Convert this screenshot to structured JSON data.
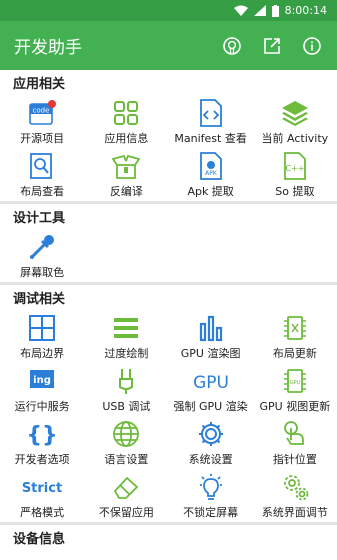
{
  "status": {
    "time": "8:00:14",
    "network": "LTE"
  },
  "app": {
    "title": "开发助手",
    "accent": "#43b152",
    "icon_color": "#6dbb3a",
    "blue": "#2b7fd8"
  },
  "sections": [
    {
      "title": "应用相关",
      "items": [
        {
          "label": "开源项目",
          "icon": "code-icon"
        },
        {
          "label": "应用信息",
          "icon": "apps-grid-icon"
        },
        {
          "label": "Manifest 查看",
          "icon": "code-file-icon"
        },
        {
          "label": "当前 Activity",
          "icon": "layers-icon"
        },
        {
          "label": "布局查看",
          "icon": "layout-search-icon"
        },
        {
          "label": "反编译",
          "icon": "box-open-icon"
        },
        {
          "label": "Apk 提取",
          "icon": "apk-file-icon"
        },
        {
          "label": "So 提取",
          "icon": "cpp-file-icon"
        }
      ]
    },
    {
      "title": "设计工具",
      "items": [
        {
          "label": "屏幕取色",
          "icon": "eyedropper-icon"
        }
      ]
    },
    {
      "title": "调试相关",
      "items": [
        {
          "label": "布局边界",
          "icon": "layout-bounds-icon"
        },
        {
          "label": "过度绘制",
          "icon": "menu-lines-icon"
        },
        {
          "label": "GPU 渲染图",
          "icon": "bar-chart-icon"
        },
        {
          "label": "布局更新",
          "icon": "chip-icon"
        },
        {
          "label": "运行中服务",
          "icon": "ing-icon"
        },
        {
          "label": "USB 调试",
          "icon": "usb-icon"
        },
        {
          "label": "强制 GPU 渲染",
          "icon": "gpu-text-icon"
        },
        {
          "label": "GPU 视图更新",
          "icon": "gpu-chip-icon"
        },
        {
          "label": "开发者选项",
          "icon": "braces-icon"
        },
        {
          "label": "语言设置",
          "icon": "globe-icon"
        },
        {
          "label": "系统设置",
          "icon": "gear-icon"
        },
        {
          "label": "指针位置",
          "icon": "pointer-hand-icon"
        },
        {
          "label": "严格模式",
          "icon": "strict-text-icon"
        },
        {
          "label": "不保留应用",
          "icon": "eraser-icon"
        },
        {
          "label": "不锁定屏幕",
          "icon": "bulb-icon"
        },
        {
          "label": "系统界面调节",
          "icon": "gears-icon"
        }
      ]
    },
    {
      "title": "设备信息",
      "items": []
    }
  ]
}
